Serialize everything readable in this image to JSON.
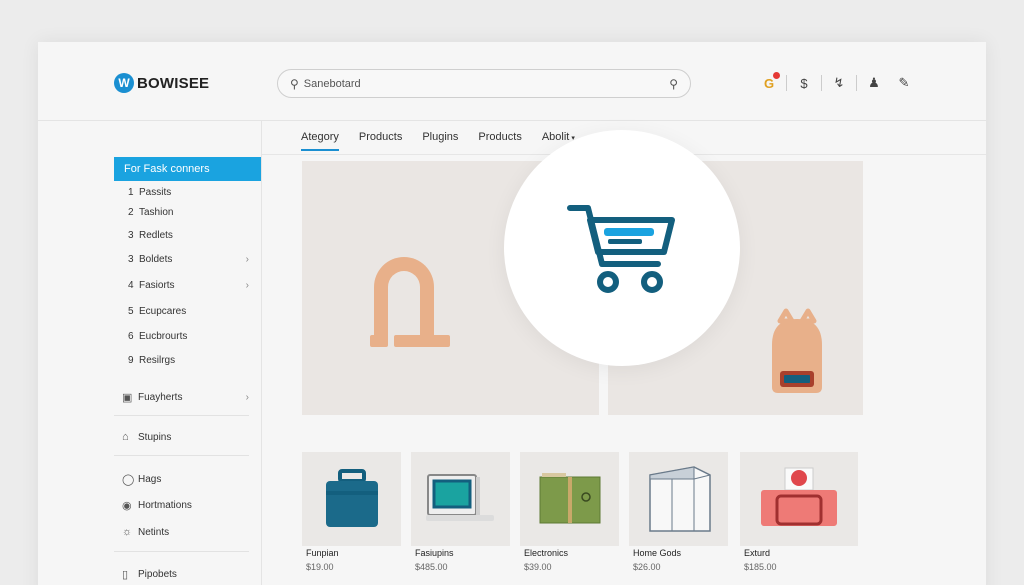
{
  "header": {
    "logo_text": "BOWISEE",
    "search_value": "Sanebotard"
  },
  "tabs": [
    {
      "label": "Ategory"
    },
    {
      "label": "Products"
    },
    {
      "label": "Plugins"
    },
    {
      "label": "Products"
    },
    {
      "label": "Abolit"
    }
  ],
  "sidebar": {
    "heading": "For Fask conners",
    "items": [
      {
        "num": "1",
        "label": "Passits"
      },
      {
        "num": "2",
        "label": "Tashion"
      },
      {
        "num": "3",
        "label": "Redlets"
      },
      {
        "num": "3",
        "label": "Boldets"
      },
      {
        "num": "4",
        "label": "Fasiorts"
      },
      {
        "num": "5",
        "label": "Ecupcares"
      },
      {
        "num": "6",
        "label": "Eucbrourts"
      },
      {
        "num": "9",
        "label": "Resilrgs"
      }
    ],
    "groups": [
      {
        "label": "Fuayherts",
        "icon": "gift-icon"
      },
      {
        "label": "Stupins",
        "icon": "store-icon"
      },
      {
        "label": "Hags",
        "icon": "tag-icon"
      },
      {
        "label": "Hortmations",
        "icon": "info-icon"
      },
      {
        "label": "Netints",
        "icon": "globe-icon"
      },
      {
        "label": "Pipobets",
        "icon": "box-icon"
      }
    ]
  },
  "products": [
    {
      "name": "Funpian",
      "price": "$19.00"
    },
    {
      "name": "Fasiupins",
      "price": "$485.00"
    },
    {
      "name": "Electronics",
      "price": "$39.00"
    },
    {
      "name": "Home Gods",
      "price": "$26.00"
    },
    {
      "name": "Exturd",
      "price": "$185.00"
    }
  ],
  "colors": {
    "accent": "#1aa3e0",
    "cart": "#135f7e",
    "backpack": "#e8b08a"
  }
}
